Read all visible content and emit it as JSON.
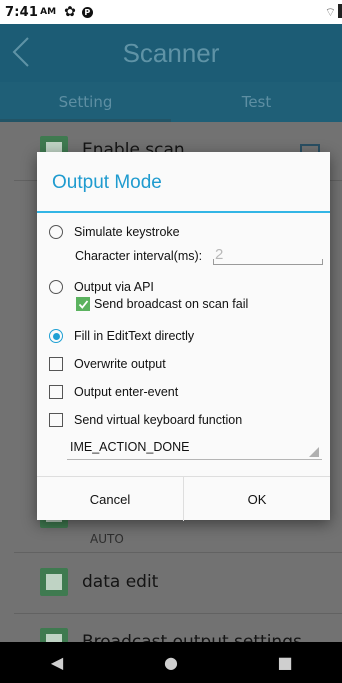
{
  "status": {
    "time": "7:41",
    "ampm": "AM"
  },
  "app": {
    "title": "Scanner"
  },
  "tabs": [
    {
      "label": "Setting",
      "active": true
    },
    {
      "label": "Test",
      "active": false
    }
  ],
  "list": {
    "items": [
      {
        "label": "Enable scan"
      },
      {
        "label": "",
        "sub": "AUTO"
      },
      {
        "label": "data edit"
      },
      {
        "label": "Broadcast output settings"
      }
    ]
  },
  "dialog": {
    "title": "Output Mode",
    "options": {
      "simulate": {
        "label": "Simulate keystroke",
        "selected": false
      },
      "interval_label": "Character interval(ms):",
      "interval_value": "2",
      "api": {
        "label": "Output via API",
        "selected": false
      },
      "broadcast_fail": {
        "label": "Send broadcast on scan fail",
        "checked": true
      },
      "edittext": {
        "label": "Fill in EditText directly",
        "selected": true
      },
      "overwrite": {
        "label": "Overwrite output",
        "checked": false
      },
      "enter_event": {
        "label": "Output enter-event",
        "checked": false
      },
      "virtual_kb": {
        "label": "Send virtual keyboard function",
        "checked": false
      }
    },
    "ime_action": "IME_ACTION_DONE",
    "cancel_label": "Cancel",
    "ok_label": "OK"
  },
  "colors": {
    "accent": "#33b5e5",
    "radio_on": "#1fa0d4",
    "green_check": "#5bb25f",
    "appbar": "#1c5c75"
  },
  "icons": [
    "settings-gear-icon",
    "back-chevron-icon",
    "checkmark-icon",
    "nav-back-icon",
    "nav-home-icon",
    "nav-recents-icon"
  ]
}
